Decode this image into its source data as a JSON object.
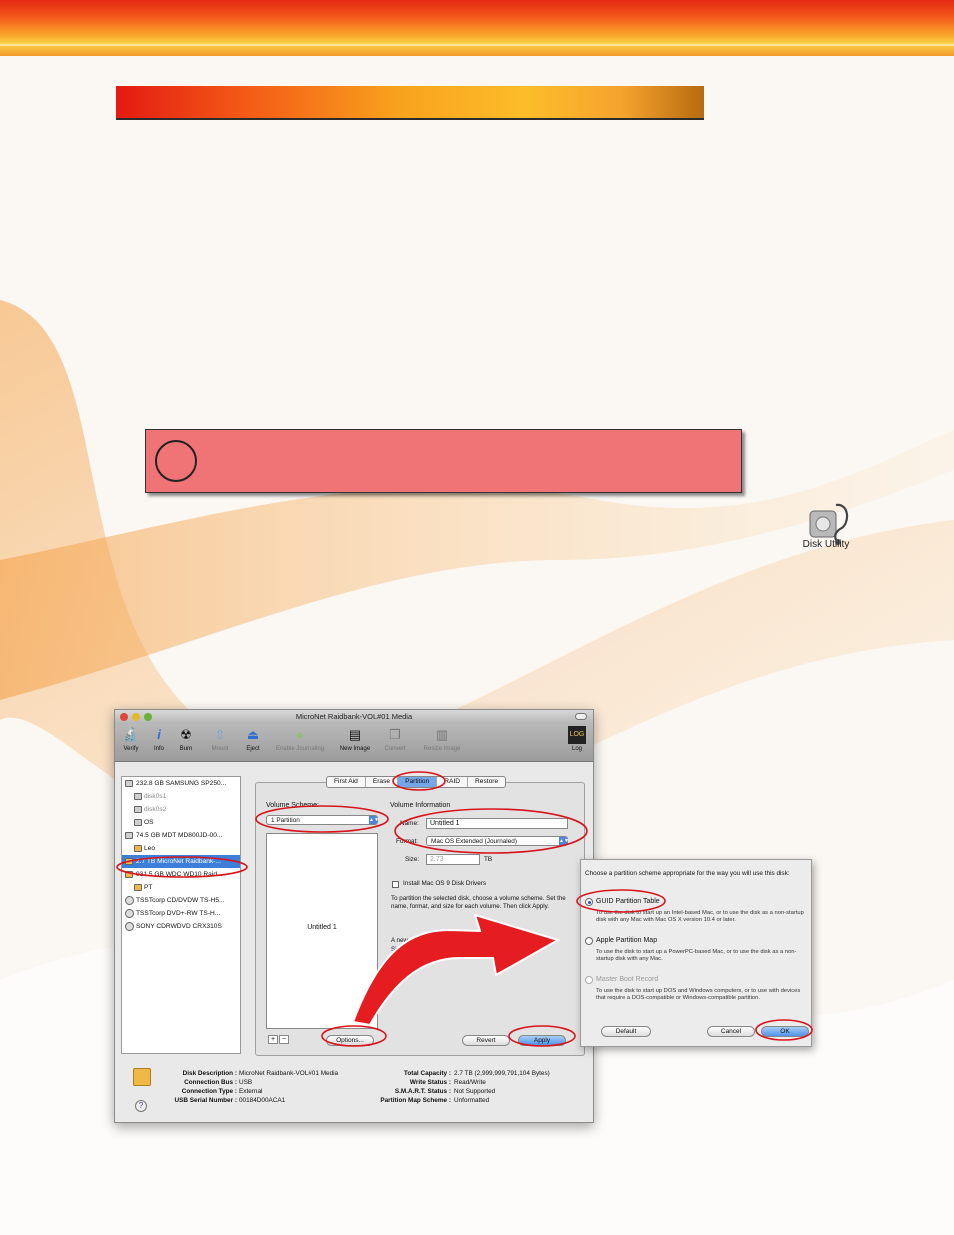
{
  "colors": {
    "accent_red": "#e32a12",
    "accent_orange": "#f9a428",
    "warning_box": "#f07475",
    "annotation_red": "#d8141b",
    "selection_blue": "#3d7fd8"
  },
  "desktop": {
    "disk_utility_label": "Disk Utility",
    "disk_utility_icon": "disk-utility-stethoscope-icon"
  },
  "window": {
    "title": "MicroNet Raidbank-VOL#01 Media",
    "toolbar": [
      {
        "label": "Verify",
        "icon": "microscope-icon"
      },
      {
        "label": "Info",
        "icon": "info-icon"
      },
      {
        "label": "Burn",
        "icon": "burn-icon"
      },
      {
        "label": "Mount",
        "icon": "mount-icon"
      },
      {
        "label": "Eject",
        "icon": "eject-icon"
      },
      {
        "label": "Enable Journaling",
        "icon": "journal-icon"
      },
      {
        "label": "New Image",
        "icon": "new-image-icon"
      },
      {
        "label": "Convert",
        "icon": "convert-icon"
      },
      {
        "label": "Resize Image",
        "icon": "resize-image-icon"
      },
      {
        "label": "Log",
        "icon": "log-icon"
      }
    ],
    "sidebar": [
      {
        "label": "232.8 GB SAMSUNG SP250..."
      },
      {
        "label": "disk0s1"
      },
      {
        "label": "disk0s2"
      },
      {
        "label": "OS"
      },
      {
        "label": "74.5 GB MDT MD800JD-00..."
      },
      {
        "label": "Leo"
      },
      {
        "label": "2.7 TB MicroNet Raidbank-..."
      },
      {
        "label": "931.5 GB WDC WD10 Raid..."
      },
      {
        "label": "PT"
      },
      {
        "label": "TSSTcorp CD/DVDW TS-H5..."
      },
      {
        "label": "TSSTcorp DVD+-RW TS-H..."
      },
      {
        "label": "SONY CDRWDVD CRX310S"
      }
    ],
    "tabs": [
      "First Aid",
      "Erase",
      "Partition",
      "RAID",
      "Restore"
    ],
    "volume_scheme_label": "Volume Scheme:",
    "volume_scheme_value": "1 Partition",
    "volume_info_label": "Volume Information",
    "name_label": "Name:",
    "name_value": "Untitled 1",
    "format_label": "Format:",
    "format_value": "Mac OS Extended (Journaled)",
    "size_label": "Size:",
    "size_value": "2.73",
    "size_unit": "TB",
    "install_drivers_label": "Install Mac OS 9 Disk Drivers",
    "instructions": "To partition the selected disk, choose a volume scheme. Set the name, format, and size for each volume. Then click Apply.",
    "new_volume_line1": "A new volume will be",
    "new_volume_line2": "Size: 2.7 TB",
    "partition_label": "Untitled 1",
    "add_btn": "+",
    "remove_btn": "−",
    "options_btn": "Options...",
    "revert_btn": "Revert",
    "apply_btn": "Apply",
    "info": {
      "disk_description_k": "Disk Description :",
      "disk_description_v": "MicroNet Raidbank-VOL#01 Media",
      "connection_bus_k": "Connection Bus :",
      "connection_bus_v": "USB",
      "connection_type_k": "Connection Type :",
      "connection_type_v": "External",
      "usb_serial_k": "USB Serial Number :",
      "usb_serial_v": "00184D00ACA1",
      "total_capacity_k": "Total Capacity :",
      "total_capacity_v": "2.7 TB (2,999,999,791,104 Bytes)",
      "write_status_k": "Write Status :",
      "write_status_v": "Read/Write",
      "smart_status_k": "S.M.A.R.T. Status :",
      "smart_status_v": "Not Supported",
      "partition_map_k": "Partition Map Scheme :",
      "partition_map_v": "Unformatted",
      "help": "?"
    }
  },
  "dialog": {
    "prompt": "Choose a partition scheme appropriate for the way you will use this disk:",
    "options": [
      {
        "label": "GUID Partition Table",
        "desc": "To use the disk to start up an Intel-based Mac, or to use the disk as a non-startup disk with any Mac with Mac OS X version 10.4 or later.",
        "selected": true
      },
      {
        "label": "Apple Partition Map",
        "desc": "To use the disk to start up a PowerPC-based Mac, or to use the disk as a non-startup disk with any Mac.",
        "selected": false
      },
      {
        "label": "Master Boot Record",
        "desc": "To use the disk to start up DOS and Windows computers, or to use with devices that require a DOS-compatible or Windows-compatible partition.",
        "selected": false
      }
    ],
    "default_btn": "Default",
    "cancel_btn": "Cancel",
    "ok_btn": "OK"
  }
}
